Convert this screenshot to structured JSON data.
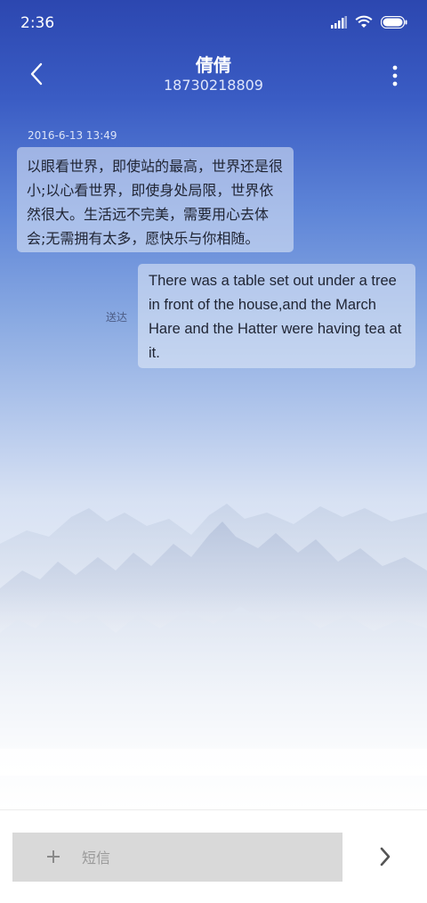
{
  "status_bar": {
    "time": "2:36"
  },
  "header": {
    "contact_name": "倩倩",
    "phone_number": "18730218809"
  },
  "conversation": {
    "timestamp": "2016-6-13 13:49",
    "messages": [
      {
        "direction": "incoming",
        "text": "以眼看世界，即使站的最高，世界还是很小;以心看世界，即使身处局限，世界依然很大。生活远不完美，需要用心去体会;无需拥有太多，愿快乐与你相随。"
      },
      {
        "direction": "outgoing",
        "text": "There was a table set out under a tree in front of the house,and the March Hare and the Hatter were having tea at it.",
        "status": "送达"
      }
    ]
  },
  "composer": {
    "placeholder": "短信"
  },
  "icons": {
    "back": "chevron-left-icon",
    "more": "more-vertical-icon",
    "add": "plus-icon",
    "send": "chevron-right-icon",
    "signal": "signal-icon",
    "wifi": "wifi-icon",
    "battery": "battery-icon"
  },
  "colors": {
    "header_blue": "#2c47b0",
    "bubble": "#e6ecf7",
    "input_box": "#d9d9d9"
  }
}
